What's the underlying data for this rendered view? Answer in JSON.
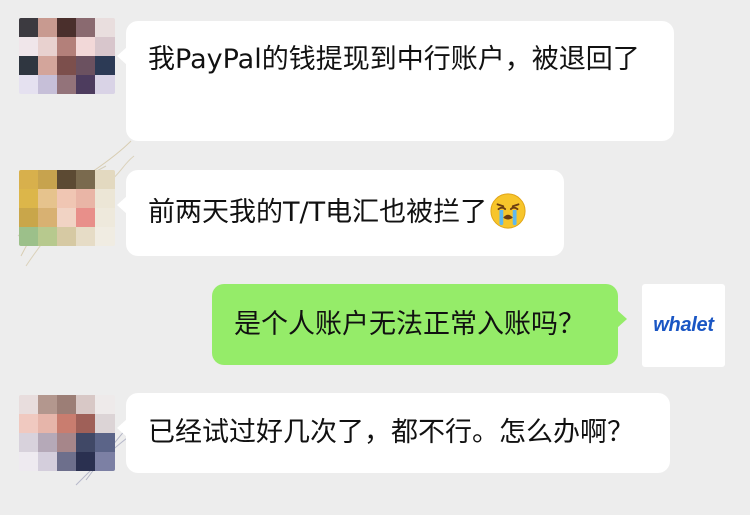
{
  "messages": [
    {
      "sender": "user-1",
      "direction": "incoming",
      "text": "我PayPal的钱提现到中行账户，被退回了"
    },
    {
      "sender": "user-2",
      "direction": "incoming",
      "text": "前两天我的T/T电汇也被拦了",
      "emoji": "crying-face-icon"
    },
    {
      "sender": "whalet",
      "direction": "outgoing",
      "text": "是个人账户无法正常入账吗？"
    },
    {
      "sender": "user-3",
      "direction": "incoming",
      "text": "已经试过好几次了，都不行。怎么办啊？"
    }
  ],
  "whalet_avatar": {
    "logo_text": "whalet"
  },
  "colors": {
    "background": "#ededed",
    "incoming_bubble": "#ffffff",
    "outgoing_bubble": "#95ec69",
    "logo_blue": "#1a56c4"
  }
}
